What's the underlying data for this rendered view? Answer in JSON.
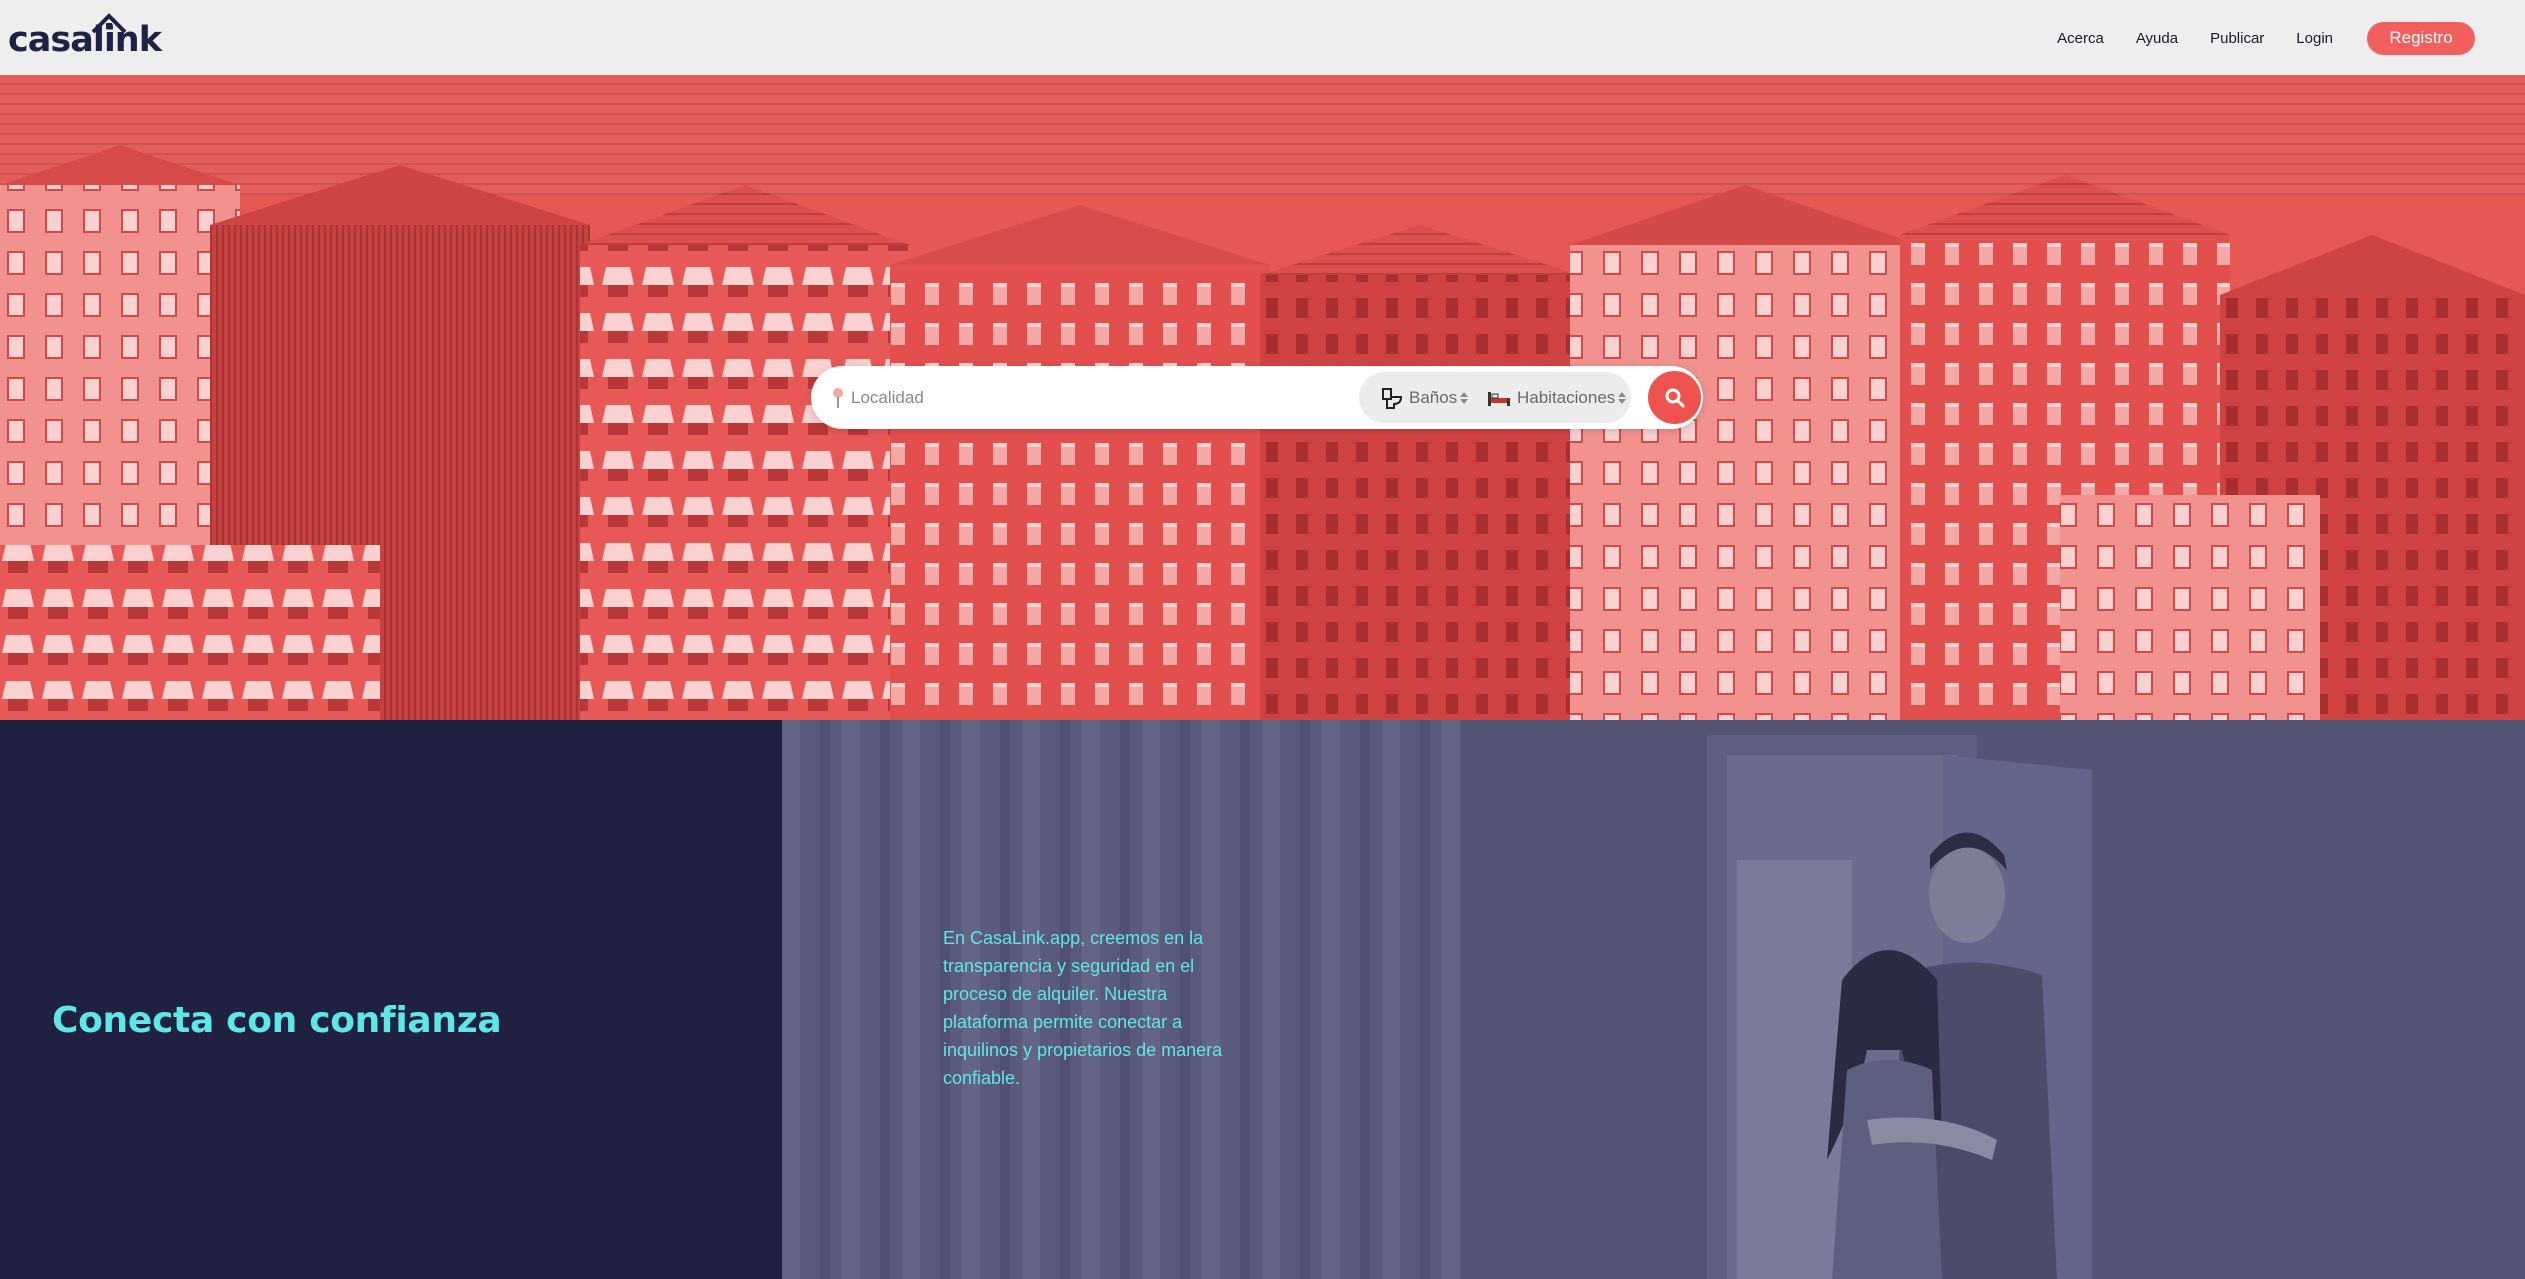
{
  "brand": {
    "logo_text": "casalink"
  },
  "nav": {
    "links": [
      "Acerca",
      "Ayuda",
      "Publicar",
      "Login"
    ],
    "register_label": "Registro"
  },
  "search": {
    "location_placeholder": "Localidad",
    "bathrooms_label": "Baños",
    "rooms_label": "Habitaciones"
  },
  "section": {
    "headline": "Conecta con confianza",
    "body": "En CasaLink.app, creemos en la transparencia y seguridad en el proceso de alquiler. Nuestra plataforma permite conectar a inquilinos y propietarios de manera confiable."
  },
  "colors": {
    "accent": "#f25f5c",
    "hero_tint": "#e75754",
    "navbar_bg": "#eeeeee",
    "dark_panel": "#202140",
    "photo_tint": "#545575",
    "headline_text": "#5de8e8"
  },
  "icons": {
    "logo": "house-roof-icon",
    "location": "pin-icon",
    "bathrooms": "toilet-icon",
    "rooms": "bed-icon",
    "search": "search-icon"
  }
}
